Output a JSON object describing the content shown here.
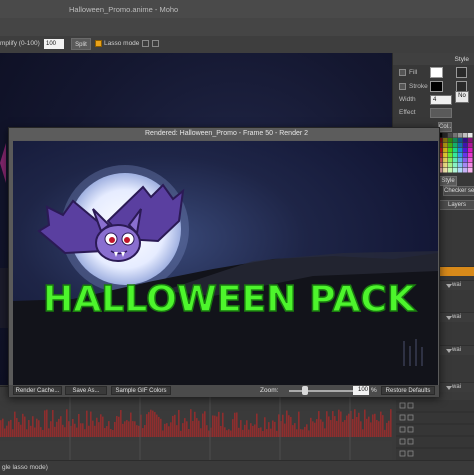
{
  "app": {
    "window_title": "Halloween_Promo.anime - Moho"
  },
  "tool_options": {
    "simplify_label": "mplify (0-100)",
    "simplify_value": "100",
    "split_label": "Split",
    "lasso_mode_label": "Lasso mode",
    "lasso_mode_checked": true
  },
  "style_panel": {
    "header": "Style",
    "fill_label": "Fill",
    "stroke_label": "Stroke",
    "width_label": "Width",
    "width_value": "4",
    "effect_label": "Effect",
    "no_label": "No",
    "style_label": "Style",
    "col_label": "Col...",
    "checker_label": "Checker se",
    "layers_label": "Layers",
    "fill_color": "#ffffff",
    "stroke_color": "#000000"
  },
  "layers": {
    "rows": [
      {
        "label": "wai"
      },
      {
        "label": "wai"
      },
      {
        "label": "wai"
      },
      {
        "label": "wai"
      }
    ]
  },
  "render_window": {
    "title": "Rendered: Halloween_Promo - Frame 50 - Render 2",
    "headline": "HALLOWEEN PACK",
    "render_cache_label": "Render Cache...",
    "save_as_label": "Save As...",
    "sample_gif_label": "Sample GIF Colors",
    "zoom_label": "Zoom:",
    "zoom_value": "100",
    "zoom_unit": "%",
    "restore_defaults_label": "Restore Defaults",
    "zoom_fraction": 0.25
  },
  "status_bar": {
    "text": "gle lasso mode)"
  },
  "colors": {
    "accent": "#e9a21a",
    "headline_green": "#4df52c",
    "bat_purple": "#7e5cc4",
    "moon": "#eef2ff"
  }
}
